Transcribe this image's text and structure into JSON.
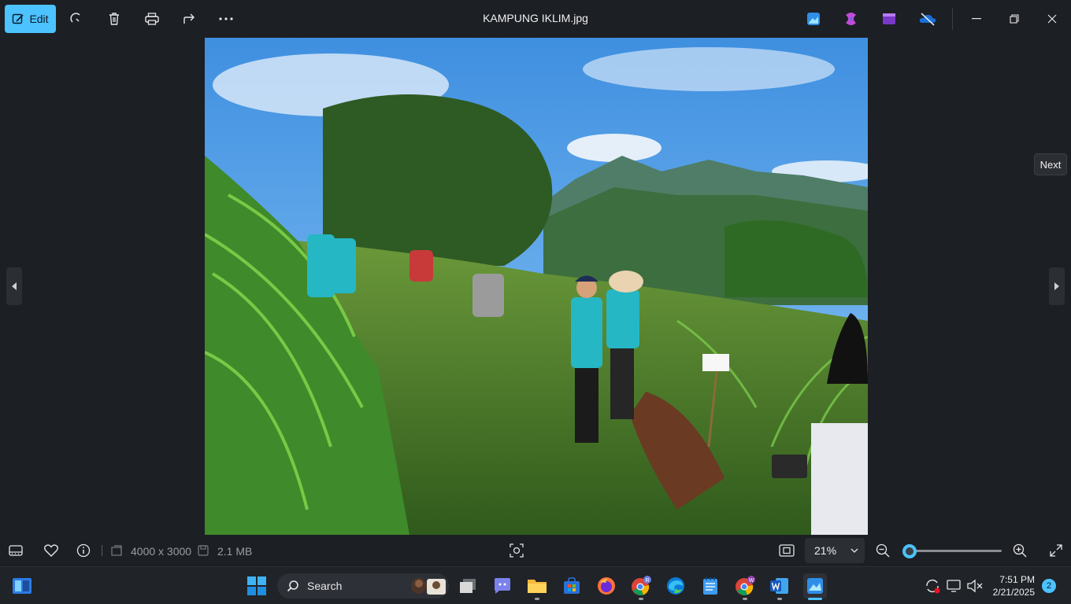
{
  "window": {
    "title": "KAMPUNG IKLIM.jpg"
  },
  "toolbar": {
    "edit_label": "Edit",
    "icons": [
      "rotate-icon",
      "delete-icon",
      "print-icon",
      "share-icon",
      "more-icon"
    ]
  },
  "tooltip": {
    "next": "Next"
  },
  "info": {
    "dimensions": "4000 x 3000",
    "filesize": "2.1 MB",
    "zoom": "21%",
    "zoom_level": 0.0
  },
  "taskbar": {
    "search_placeholder": "Search",
    "time": "7:51 PM",
    "date": "2/21/2025",
    "notifications": "2",
    "chrome_badge_1": "R",
    "chrome_badge_2": "W"
  },
  "colors": {
    "accent": "#4cc2ff",
    "background": "#1c1f24",
    "taskbar": "#202328"
  }
}
